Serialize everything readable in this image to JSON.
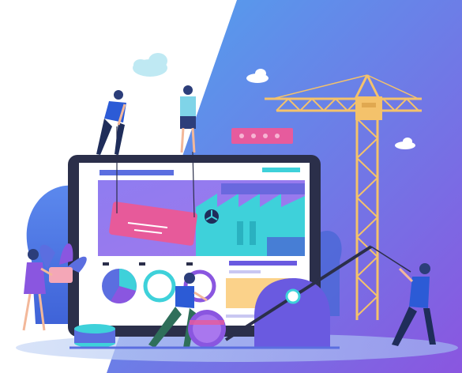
{
  "illustration": {
    "subject": "website-construction",
    "icons": [
      "cloud-icon",
      "crane-icon",
      "gear-icon",
      "pie-chart-icon",
      "donut-chart-icon",
      "pen-tool-icon",
      "database-icon",
      "plant-icon"
    ],
    "colors": {
      "sky_gradient_start": "#4ea6ee",
      "sky_gradient_end": "#8a56e0",
      "crane": "#f4c26b",
      "tablet_frame": "#2b2f4a",
      "factory": "#3ed1da",
      "banner": "#e75a9a",
      "person_shirt": "#2c5bd6",
      "person_pants": "#263a78",
      "accent_purple": "#7a4dd9",
      "accent_yellow": "#fbd28a"
    }
  }
}
